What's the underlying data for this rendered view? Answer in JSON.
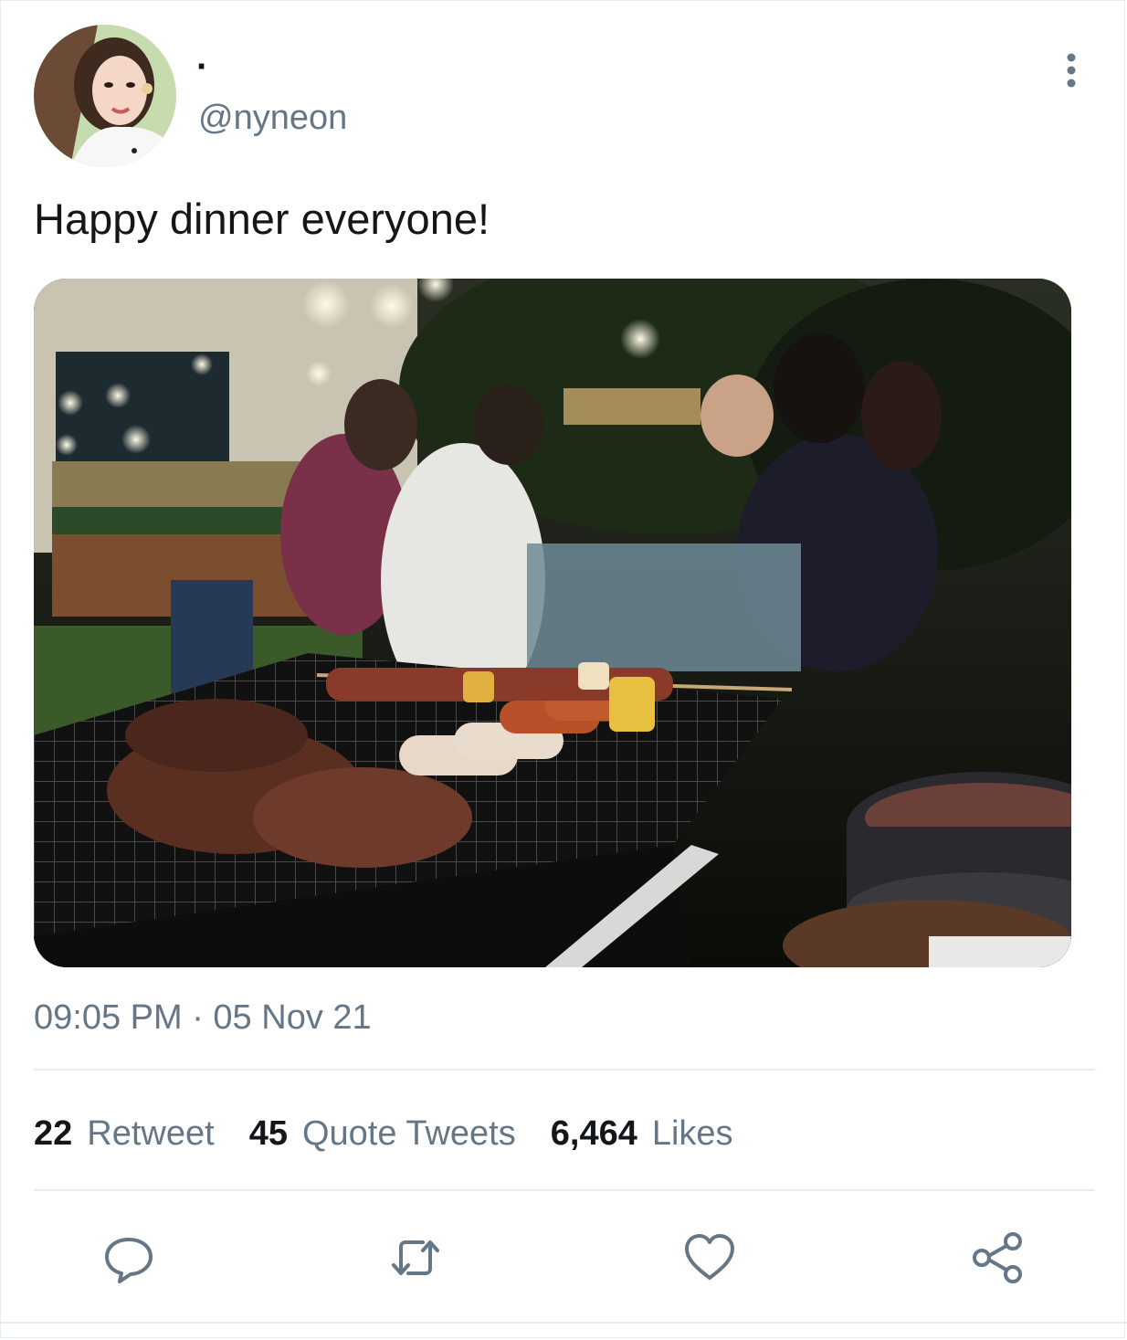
{
  "tweet": {
    "display_name": "·",
    "handle": "@nyneon",
    "text": "Happy dinner everyone!",
    "timestamp": "09:05 PM · 05 Nov 21",
    "avatar_icon": "profile-photo",
    "media_icon": "bbq-dinner-photo"
  },
  "stats": {
    "retweets": {
      "count": "22",
      "label": "Retweet"
    },
    "quotes": {
      "count": "45",
      "label": "Quote Tweets"
    },
    "likes": {
      "count": "6,464",
      "label": "Likes"
    }
  },
  "actions": [
    {
      "name": "reply",
      "icon": "reply-icon"
    },
    {
      "name": "retweet",
      "icon": "retweet-icon"
    },
    {
      "name": "like",
      "icon": "heart-icon"
    },
    {
      "name": "share",
      "icon": "share-icon"
    }
  ],
  "colors": {
    "primary_text": "#14171a",
    "secondary_text": "#657786",
    "divider": "#e6ecf0",
    "background": "#ffffff"
  }
}
